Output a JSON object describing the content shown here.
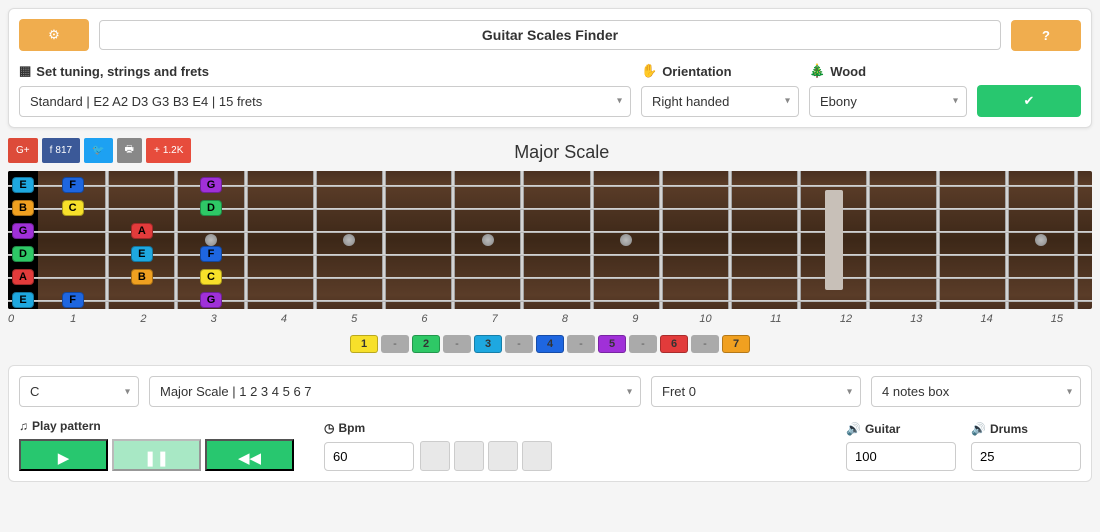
{
  "header": {
    "title": "Guitar Scales Finder"
  },
  "config": {
    "tuning_label": "Set tuning, strings and frets",
    "orientation_label": "Orientation",
    "wood_label": "Wood",
    "tuning_value": "Standard | E2 A2 D3 G3 B3 E4 | 15 frets",
    "orientation_value": "Right handed",
    "wood_value": "Ebony"
  },
  "social": {
    "fb_count": "817",
    "plus_count": "1.2K"
  },
  "scale_title": "Major Scale",
  "fretboard": {
    "frets": 15,
    "strings": [
      {
        "open": "E",
        "color": "#1ea8e0",
        "notes": [
          {
            "fret": 1,
            "label": "F",
            "color": "#1e66e0"
          },
          {
            "fret": 3,
            "label": "G",
            "color": "#a030d8"
          }
        ]
      },
      {
        "open": "B",
        "color": "#f0a020",
        "notes": [
          {
            "fret": 1,
            "label": "C",
            "color": "#f7e02a"
          },
          {
            "fret": 3,
            "label": "D",
            "color": "#2ec866"
          }
        ]
      },
      {
        "open": "G",
        "color": "#a030d8",
        "notes": [
          {
            "fret": 2,
            "label": "A",
            "color": "#e23b3b"
          },
          {
            "fret": 4,
            "label": "",
            "color": ""
          }
        ]
      },
      {
        "open": "D",
        "color": "#2ec866",
        "notes": [
          {
            "fret": 2,
            "label": "E",
            "color": "#1ea8e0"
          },
          {
            "fret": 3,
            "label": "F",
            "color": "#1e66e0"
          }
        ]
      },
      {
        "open": "A",
        "color": "#e23b3b",
        "notes": [
          {
            "fret": 2,
            "label": "B",
            "color": "#f0a020"
          },
          {
            "fret": 3,
            "label": "C",
            "color": "#f7e02a"
          }
        ]
      },
      {
        "open": "E",
        "color": "#1ea8e0",
        "notes": [
          {
            "fret": 1,
            "label": "F",
            "color": "#1e66e0"
          },
          {
            "fret": 3,
            "label": "G",
            "color": "#a030d8"
          }
        ]
      }
    ],
    "markers": [
      3,
      5,
      7,
      9,
      15
    ],
    "double_marker": 12,
    "numbers": [
      "0",
      "1",
      "2",
      "3",
      "4",
      "5",
      "6",
      "7",
      "8",
      "9",
      "10",
      "11",
      "12",
      "13",
      "14",
      "15"
    ]
  },
  "degrees": [
    {
      "n": "1",
      "color": "#f7e02a"
    },
    {
      "n": "2",
      "color": "#2ec866"
    },
    {
      "n": "3",
      "color": "#1ea8e0"
    },
    {
      "n": "4",
      "color": "#1e66e0"
    },
    {
      "n": "5",
      "color": "#a030d8"
    },
    {
      "n": "6",
      "color": "#e23b3b"
    },
    {
      "n": "7",
      "color": "#f0a020"
    }
  ],
  "selectors": {
    "root": "C",
    "scale": "Major Scale | 1 2 3 4 5 6 7",
    "fret": "Fret 0",
    "box": "4 notes box"
  },
  "play": {
    "pattern_label": "Play pattern",
    "bpm_label": "Bpm",
    "bpm_value": "60",
    "guitar_label": "Guitar",
    "guitar_value": "100",
    "drums_label": "Drums",
    "drums_value": "25"
  }
}
